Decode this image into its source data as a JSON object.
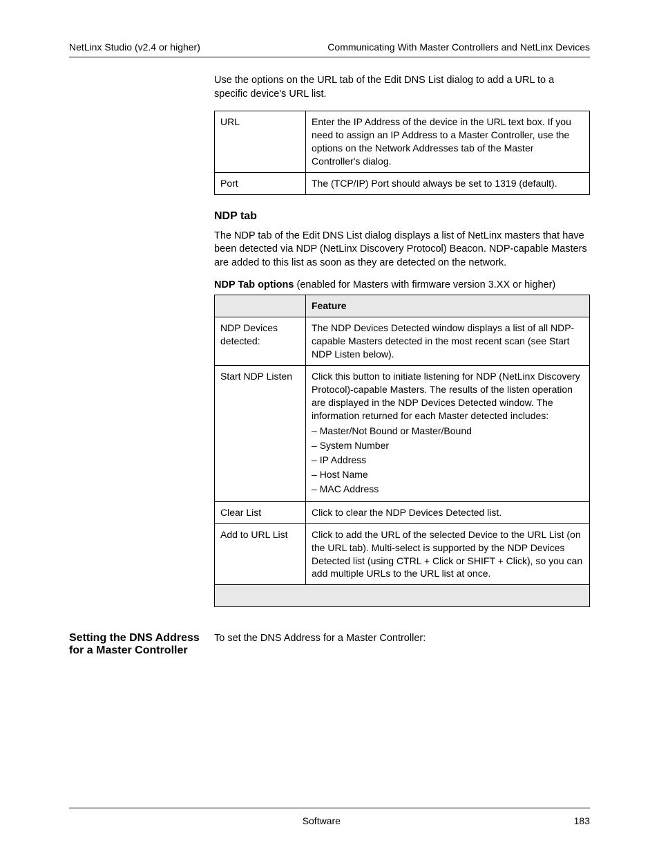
{
  "header": {
    "product": "NetLinx Studio (v2.4 or higher)",
    "section_right": "Communicating With Master Controllers and NetLinx Devices",
    "chapter_number": ""
  },
  "intro": {
    "para": "Use the options on the URL tab of the Edit DNS List dialog to add a URL to a specific device's URL list."
  },
  "table1": {
    "rows": [
      {
        "field": "URL",
        "desc": "Enter the IP Address of the device in the URL text box. If you need to assign an IP Address to a Master Controller, use the options on the Network Addresses tab of the Master Controller's dialog."
      },
      {
        "field": "Port",
        "desc": "The (TCP/IP) Port should always be set to 1319 (default)."
      }
    ]
  },
  "ndp_section": {
    "title": "NDP tab",
    "para": "The NDP tab of the Edit DNS List dialog displays a list of NetLinx masters that have been detected via NDP (NetLinx Discovery Protocol) Beacon. NDP-capable Masters are added to this list as soon as they are detected on the network."
  },
  "table2": {
    "caption_bold": "NDP Tab options",
    "caption_rest": "(enabled for Masters with firmware version 3.XX or higher)",
    "headers": [
      "",
      "Feature"
    ],
    "rows": [
      {
        "field": "NDP Devices detected:",
        "desc": "The NDP Devices Detected window displays a list of all NDP-capable Masters detected in the most recent scan (see Start NDP Listen below)."
      },
      {
        "field": "Start NDP Listen",
        "desc_intro": "Click this button to initiate listening for NDP (NetLinx Discovery Protocol)-capable Masters. The results of the listen operation are displayed in the NDP Devices Detected window. The information returned for each Master detected includes:",
        "desc_items": [
          "Master/Not Bound or Master/Bound",
          "System Number",
          "IP Address",
          "Host Name",
          "MAC Address"
        ]
      },
      {
        "field": "Clear List",
        "desc": "Click to clear the NDP Devices Detected list."
      },
      {
        "field": "Add to URL List",
        "desc": "Click to add the URL of the selected Device to the URL List (on the URL tab). Multi-select is supported by the NDP Devices Detected list (using CTRL + Click or SHIFT + Click), so you can add multiple URLs to the URL list at once."
      }
    ]
  },
  "dns_section": {
    "title": "Setting the DNS Address for a Master Controller",
    "para_lead": "To set the DNS Address for a Master Controller:"
  },
  "footer": {
    "left": "",
    "center": "Software",
    "right": "183"
  }
}
